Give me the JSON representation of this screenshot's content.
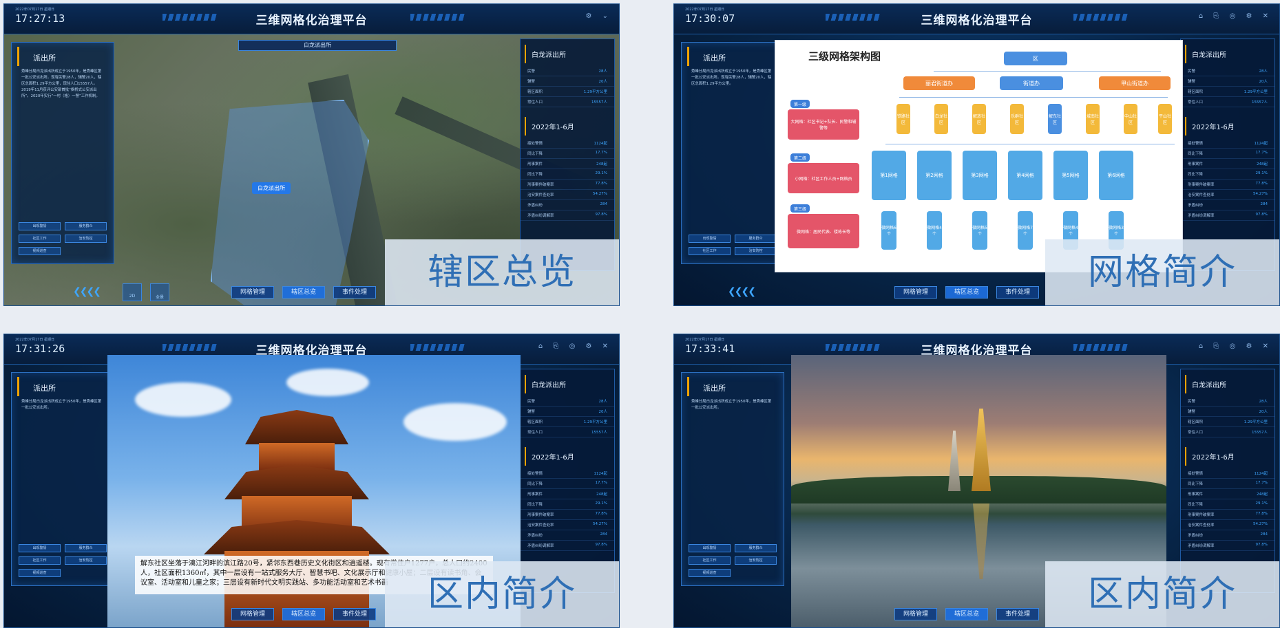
{
  "panels": [
    {
      "app_title": "三维网格化治理平台",
      "date": "2022年07月17日 星期日",
      "time": "17:27:13",
      "left": {
        "title": "派出所",
        "text": "秀峰分局白龙派出所成立于1950年，是秀峰区第一批公安派出所。现有民警28人，辅警20人，辖区总面积1.29平方公里，现住人口15557人。2019年11月获评公安部首批“枫桥式公安派出所”。2020年实行“一村（格）一警”工作机制。",
        "buttons": [
          "出现警情",
          "服务群众",
          "社区工作",
          "治安防控",
          "视频巡查"
        ]
      },
      "search": "白龙派出所",
      "map_label": "白龙派出所",
      "right": {
        "title": "白龙派出所",
        "rows": [
          [
            "民警",
            "28人"
          ],
          [
            "辅警",
            "20人"
          ],
          [
            "辖区面积",
            "1.29平方公里"
          ],
          [
            "常住人口",
            "15557人"
          ]
        ],
        "title2": "2022年1-6月",
        "rows2": [
          [
            "接处警情",
            "1124起"
          ],
          [
            "同比下降",
            "17.7%"
          ],
          [
            "刑事案件",
            "248起"
          ],
          [
            "同比下降",
            "29.1%"
          ],
          [
            "刑事案件破案率",
            "77.8%"
          ],
          [
            "治安案件查处率",
            "54.27%"
          ],
          [
            "矛盾纠纷",
            "284"
          ],
          [
            "矛盾纠纷调解率",
            "97.8%"
          ]
        ]
      },
      "nav": [
        "网格管理",
        "辖区总览",
        "事件处理"
      ],
      "modes": [
        "2D",
        "全景"
      ],
      "caption": "辖区总览"
    },
    {
      "app_title": "三维网格化治理平台",
      "date": "2022年07月17日 星期日",
      "time": "17:30:07",
      "left": {
        "title": "派出所",
        "text": "秀峰分局白龙派出所成立于1950年，是秀峰区第一批公安派出所。现有民警28人，辅警20人，辖区总面积1.29平方公里。",
        "buttons": [
          "出现警情",
          "服务群众",
          "社区工作",
          "治安防控"
        ]
      },
      "right": {
        "title": "白龙派出所",
        "rows": [
          [
            "民警",
            "28人"
          ],
          [
            "辅警",
            "20人"
          ],
          [
            "辖区面积",
            "1.29平方公里"
          ],
          [
            "常住人口",
            "15557人"
          ]
        ],
        "title2": "2022年1-6月",
        "rows2": [
          [
            "接处警情",
            "1124起"
          ],
          [
            "同比下降",
            "17.7%"
          ],
          [
            "刑事案件",
            "248起"
          ],
          [
            "同比下降",
            "29.1%"
          ],
          [
            "刑事案件破案率",
            "77.8%"
          ],
          [
            "治安案件查处率",
            "54.27%"
          ],
          [
            "矛盾纠纷",
            "284"
          ],
          [
            "矛盾纠纷调解率",
            "97.8%"
          ]
        ]
      },
      "diagram": {
        "title": "三级网格架构图",
        "root": "区",
        "streets": [
          "丽君街道办",
          "街道办",
          "甲山街道办"
        ],
        "level_tags": [
          "第一级",
          "第二级",
          "第三级"
        ],
        "level_boxes": [
          "大网格：社区书记+队长、民警和辅警等",
          "小网格：社区工作人员+网格员",
          "微网格：居民代表、楼栋长等"
        ],
        "communities": [
          "铁路社区",
          "白龙社区",
          "解放社区",
          "乐群社区",
          "解东社区",
          "城南社区",
          "中山社区",
          "平山社区"
        ],
        "grids": [
          "第1网格",
          "第2网格",
          "第3网格",
          "第4网格",
          "第5网格",
          "第6网格"
        ],
        "micro": [
          "微网格6个",
          "微网格4个",
          "微网格5个",
          "微网格7个",
          "微网格4个",
          "微网格3个"
        ]
      },
      "nav": [
        "网格管理",
        "辖区总览",
        "事件处理"
      ],
      "caption": "网格简介"
    },
    {
      "app_title": "三维网格化治理平台",
      "date": "2022年07月17日 星期日",
      "time": "17:31:26",
      "left": {
        "title": "派出所",
        "text": "秀峰分局白龙派出所成立于1950年，是秀峰区第一批公安派出所。",
        "buttons": [
          "出现警情",
          "服务群众",
          "社区工作",
          "治安防控",
          "视频巡查"
        ]
      },
      "right": {
        "title": "白龙派出所",
        "rows": [
          [
            "民警",
            "28人"
          ],
          [
            "辅警",
            "20人"
          ],
          [
            "辖区面积",
            "1.29平方公里"
          ],
          [
            "常住人口",
            "15557人"
          ]
        ],
        "title2": "2022年1-6月",
        "rows2": [
          [
            "接处警情",
            "1124起"
          ],
          [
            "同比下降",
            "17.7%"
          ],
          [
            "刑事案件",
            "248起"
          ],
          [
            "同比下降",
            "29.1%"
          ],
          [
            "刑事案件破案率",
            "77.8%"
          ],
          [
            "治安案件查处率",
            "54.27%"
          ],
          [
            "矛盾纠纷",
            "284"
          ],
          [
            "矛盾纠纷调解率",
            "97.8%"
          ]
        ]
      },
      "photo_text": "解东社区坐落于漓江河畔的滨江路20号，紧邻东西巷历史文化街区和逍遥楼。现有常住户1277户，总人口约2400人，社区面积1360㎡，其中一层设有一站式服务大厅、智慧书吧、文化展示厅和健康小屋；二层设有读书角、会议室、活动室和儿童之家；三层设有新时代文明实践站、多功能活动室和艺术书画",
      "nav": [
        "网格管理",
        "辖区总览",
        "事件处理"
      ],
      "caption": "区内简介"
    },
    {
      "app_title": "三维网格化治理平台",
      "date": "2022年07月17日 星期日",
      "time": "17:33:41",
      "left": {
        "title": "派出所",
        "text": "秀峰分局白龙派出所成立于1950年，是秀峰区第一批公安派出所。",
        "buttons": [
          "出现警情",
          "服务群众",
          "社区工作",
          "治安防控",
          "视频巡查"
        ]
      },
      "right": {
        "title": "白龙派出所",
        "rows": [
          [
            "民警",
            "28人"
          ],
          [
            "辅警",
            "20人"
          ],
          [
            "辖区面积",
            "1.29平方公里"
          ],
          [
            "常住人口",
            "15557人"
          ]
        ],
        "title2": "2022年1-6月",
        "rows2": [
          [
            "接处警情",
            "1124起"
          ],
          [
            "同比下降",
            "17.7%"
          ],
          [
            "刑事案件",
            "248起"
          ],
          [
            "同比下降",
            "29.1%"
          ],
          [
            "刑事案件破案率",
            "77.8%"
          ],
          [
            "治安案件查处率",
            "54.27%"
          ],
          [
            "矛盾纠纷",
            "284"
          ],
          [
            "矛盾纠纷调解率",
            "97.8%"
          ]
        ]
      },
      "nav": [
        "网格管理",
        "辖区总览",
        "事件处理"
      ],
      "caption": "区内简介"
    }
  ],
  "colors": {
    "accent": "#3ea6ff",
    "caption_text": "#2f6fb5",
    "marker": "#f2a400"
  }
}
